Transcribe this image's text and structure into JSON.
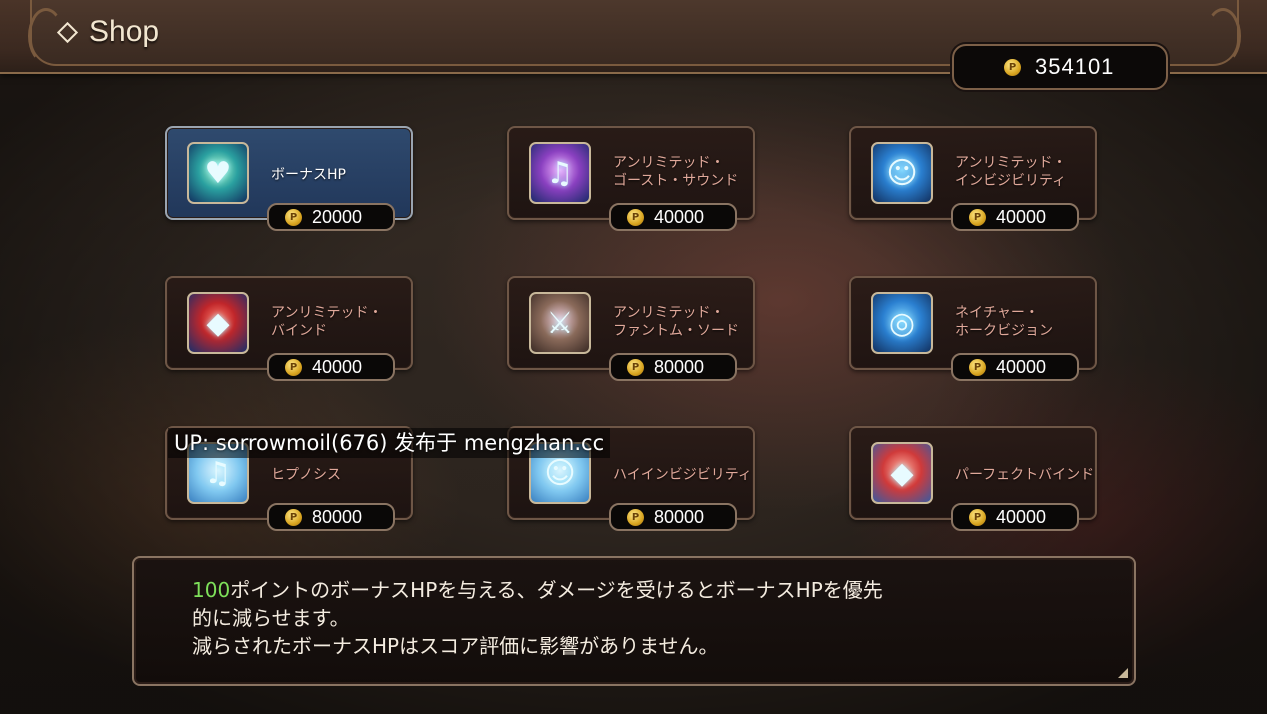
{
  "header": {
    "title": "Shop"
  },
  "points": {
    "value": "354101",
    "coin_symbol": "P"
  },
  "items": [
    {
      "name": "ボーナスHP",
      "price": "20000",
      "icon": "heart-plus-icon"
    },
    {
      "name": "アンリミテッド・\nゴースト・サウンド",
      "price": "40000",
      "icon": "music-note-icon"
    },
    {
      "name": "アンリミテッド・\nインビジビリティ",
      "price": "40000",
      "icon": "ghost-figure-icon"
    },
    {
      "name": "アンリミテッド・\nバインド",
      "price": "40000",
      "icon": "red-gem-orbit-icon"
    },
    {
      "name": "アンリミテッド・\nファントム・ソード",
      "price": "80000",
      "icon": "sword-icon"
    },
    {
      "name": "ネイチャー・\nホークビジョン",
      "price": "40000",
      "icon": "eye-sigil-icon"
    },
    {
      "name": "ヒプノシス",
      "price": "80000",
      "icon": "music-note-icon"
    },
    {
      "name": "ハイインビジビリティ",
      "price": "80000",
      "icon": "ghost-figure-icon"
    },
    {
      "name": "パーフェクトバインド",
      "price": "40000",
      "icon": "red-gem-orbit-icon"
    }
  ],
  "watermark": "UP: sorrowmoil(676) 发布于 mengzhan.cc",
  "description": {
    "highlight": "100",
    "line1_rest": "ポイントのボーナスHPを与える、ダメージを受けるとボーナスHPを優先",
    "line2": "的に減らせます。",
    "line3": "減らされたボーナスHPはスコア評価に影響がありません。"
  },
  "colors": {
    "highlight": "#7ee05a",
    "selected_card": "#2f4a6e",
    "item_name": "#e0a89a"
  }
}
